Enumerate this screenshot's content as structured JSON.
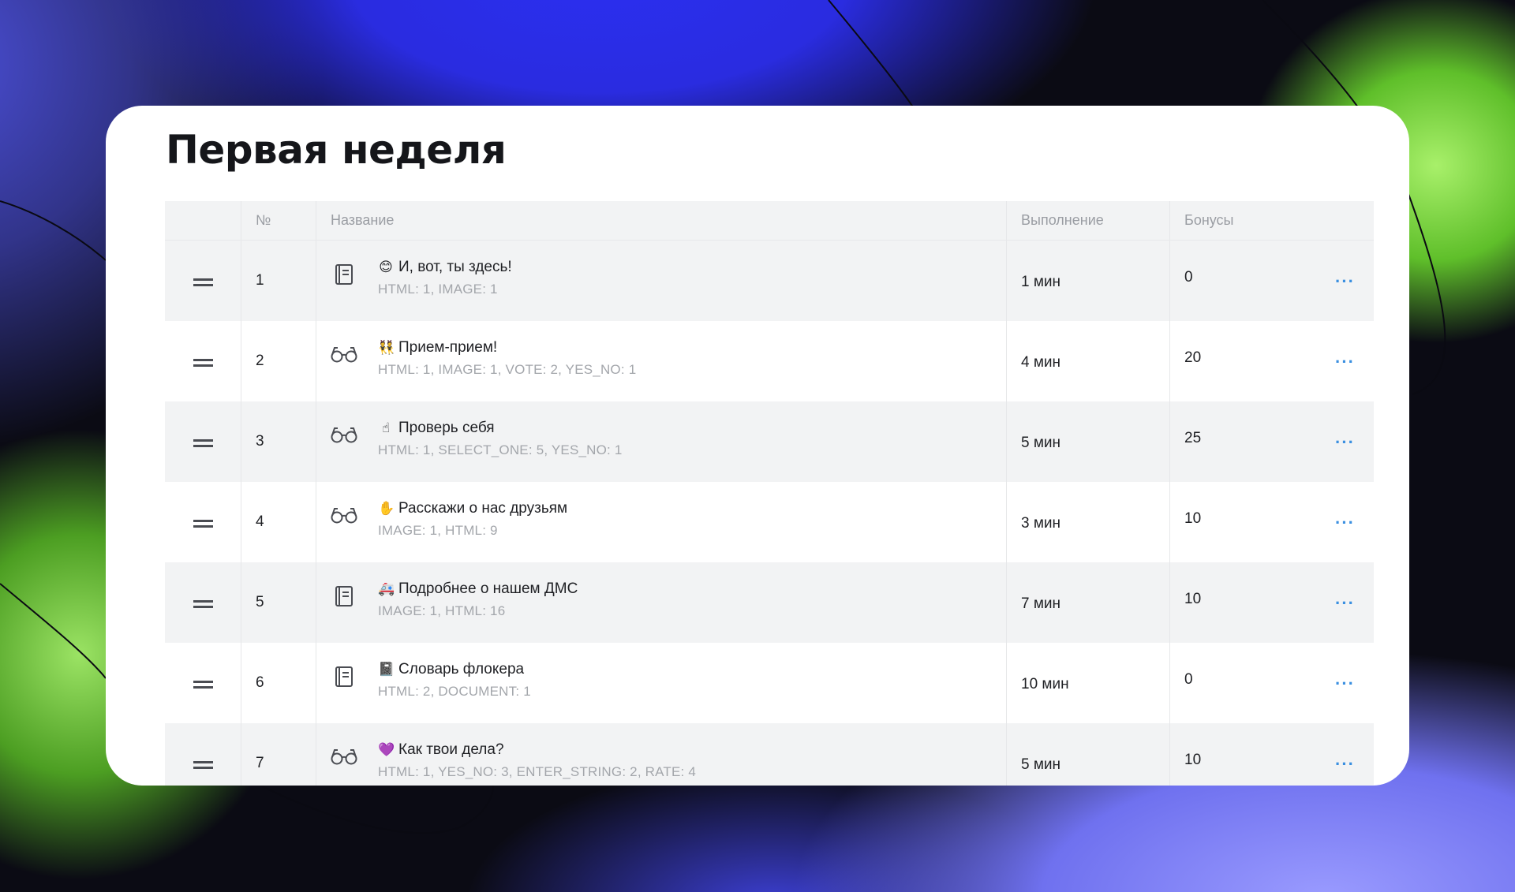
{
  "page": {
    "title": "Первая неделя"
  },
  "table": {
    "columns": {
      "number": "№",
      "name": "Название",
      "completion": "Выполнение",
      "bonuses": "Бонусы"
    },
    "rows": [
      {
        "number": "1",
        "icon": "book-icon",
        "emoji": "😊",
        "title": "И, вот, ты здесь!",
        "meta": "HTML: 1, IMAGE: 1",
        "time": "1 мин",
        "bonus": "0",
        "more": "···"
      },
      {
        "number": "2",
        "icon": "glasses-icon",
        "emoji": "👯",
        "title": "Прием-прием!",
        "meta": "HTML: 1, IMAGE: 1, VOTE: 2, YES_NO: 1",
        "time": "4 мин",
        "bonus": "20",
        "more": "···"
      },
      {
        "number": "3",
        "icon": "glasses-icon",
        "emoji": "☝",
        "title": "Проверь себя",
        "meta": "HTML: 1, SELECT_ONE: 5, YES_NO: 1",
        "time": "5 мин",
        "bonus": "25",
        "more": "···"
      },
      {
        "number": "4",
        "icon": "glasses-icon",
        "emoji": "✋",
        "title": "Расскажи о нас друзьям",
        "meta": "IMAGE: 1, HTML: 9",
        "time": "3 мин",
        "bonus": "10",
        "more": "···"
      },
      {
        "number": "5",
        "icon": "book-icon",
        "emoji": "🚑",
        "title": "Подробнее о нашем ДМС",
        "meta": "IMAGE: 1, HTML: 16",
        "time": "7 мин",
        "bonus": "10",
        "more": "···"
      },
      {
        "number": "6",
        "icon": "book-icon",
        "emoji": "📓",
        "title": "Словарь флокера",
        "meta": "HTML: 2, DOCUMENT: 1",
        "time": "10 мин",
        "bonus": "0",
        "more": "···"
      },
      {
        "number": "7",
        "icon": "glasses-icon",
        "emoji": "💜",
        "title": "Как твои дела?",
        "meta": "HTML: 1, YES_NO: 3, ENTER_STRING: 2, RATE: 4",
        "time": "5 мин",
        "bonus": "10",
        "more": "···"
      }
    ]
  },
  "colors": {
    "accent": "#3a8fe0",
    "text": "#1f2024",
    "muted": "#a3a6ab",
    "row_alt": "#f2f3f4"
  }
}
